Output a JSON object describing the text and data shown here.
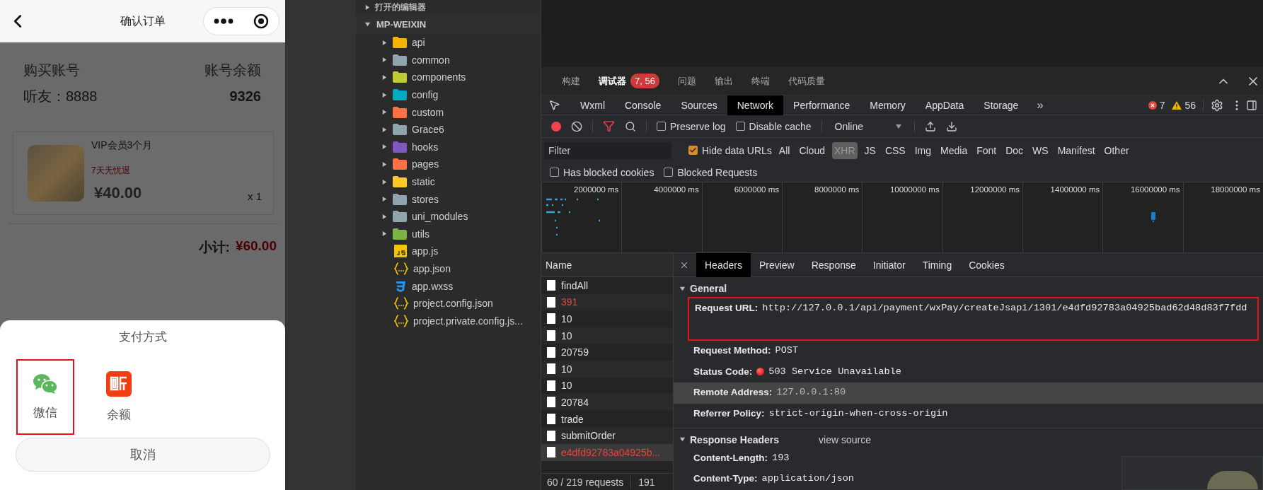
{
  "phone": {
    "nav_title": "确认订单",
    "account": {
      "label": "购买账号",
      "value": "听友：8888"
    },
    "balance": {
      "label": "账号余额",
      "value": "9326"
    },
    "product": {
      "title": "VIP会员3个月",
      "tag": "7天无忧退",
      "price": "¥40.00",
      "quantity": "x 1"
    },
    "subtotal": {
      "label": "小计:",
      "amount": "¥60.00"
    },
    "payment_sheet": {
      "title": "支付方式",
      "methods": [
        {
          "label": "微信",
          "kind": "wechat",
          "highlighted": true
        },
        {
          "label": "余额",
          "kind": "balance",
          "highlighted": false
        }
      ],
      "cancel": "取消"
    }
  },
  "explorer": {
    "open_editors": "打开的编辑器",
    "project": "MP-WEIXIN",
    "items": [
      {
        "name": "api",
        "kind": "folder",
        "color": "#f5b400"
      },
      {
        "name": "common",
        "kind": "folder",
        "color": "#90a4ae"
      },
      {
        "name": "components",
        "kind": "folder",
        "color": "#c0ca33"
      },
      {
        "name": "config",
        "kind": "folder",
        "color": "#00acc1"
      },
      {
        "name": "custom",
        "kind": "folder",
        "color": "#ff7043"
      },
      {
        "name": "Grace6",
        "kind": "folder",
        "color": "#90a4ae"
      },
      {
        "name": "hooks",
        "kind": "folder",
        "color": "#7e57c2"
      },
      {
        "name": "pages",
        "kind": "folder",
        "color": "#ff7043"
      },
      {
        "name": "static",
        "kind": "folder",
        "color": "#ffca28"
      },
      {
        "name": "stores",
        "kind": "folder",
        "color": "#90a4ae"
      },
      {
        "name": "uni_modules",
        "kind": "folder",
        "color": "#90a4ae"
      },
      {
        "name": "utils",
        "kind": "folder",
        "color": "#7cb342"
      },
      {
        "name": "app.js",
        "kind": "js"
      },
      {
        "name": "app.json",
        "kind": "json"
      },
      {
        "name": "app.wxss",
        "kind": "css"
      },
      {
        "name": "project.config.json",
        "kind": "json"
      },
      {
        "name": "project.private.config.js...",
        "kind": "json"
      }
    ]
  },
  "devtools": {
    "top_tabs": [
      {
        "label": "构建",
        "selected": false
      },
      {
        "label": "调试器",
        "selected": true,
        "badge": "7, 56"
      },
      {
        "label": "问题",
        "selected": false
      },
      {
        "label": "输出",
        "selected": false
      },
      {
        "label": "终端",
        "selected": false
      },
      {
        "label": "代码质量",
        "selected": false
      }
    ],
    "panel_tabs": [
      {
        "label": "Wxml",
        "selected": false
      },
      {
        "label": "Console",
        "selected": false
      },
      {
        "label": "Sources",
        "selected": false
      },
      {
        "label": "Network",
        "selected": true
      },
      {
        "label": "Performance",
        "selected": false
      },
      {
        "label": "Memory",
        "selected": false
      },
      {
        "label": "AppData",
        "selected": false
      },
      {
        "label": "Storage",
        "selected": false
      }
    ],
    "more_tabs": "»",
    "error_count": "7",
    "warning_count": "56",
    "toolbar": {
      "recording": true,
      "checkboxes": [
        {
          "label": "Preserve log",
          "checked": false
        },
        {
          "label": "Disable cache",
          "checked": false
        }
      ],
      "throttling": "Online"
    },
    "filter": {
      "placeholder": "Filter",
      "hide_data_urls": {
        "label": "Hide data URLs",
        "checked": true
      },
      "types": [
        {
          "label": "All",
          "selected": false
        },
        {
          "label": "Cloud",
          "selected": false
        },
        {
          "label": "XHR",
          "selected": true
        },
        {
          "label": "JS",
          "selected": false
        },
        {
          "label": "CSS",
          "selected": false
        },
        {
          "label": "Img",
          "selected": false
        },
        {
          "label": "Media",
          "selected": false
        },
        {
          "label": "Font",
          "selected": false
        },
        {
          "label": "Doc",
          "selected": false
        },
        {
          "label": "WS",
          "selected": false
        },
        {
          "label": "Manifest",
          "selected": false
        },
        {
          "label": "Other",
          "selected": false
        }
      ]
    },
    "blocked_filters": [
      {
        "label": "Has blocked cookies",
        "checked": false
      },
      {
        "label": "Blocked Requests",
        "checked": false
      }
    ],
    "timeline_ticks": [
      "2000000 ms",
      "4000000 ms",
      "6000000 ms",
      "8000000 ms",
      "10000000 ms",
      "12000000 ms",
      "14000000 ms",
      "16000000 ms",
      "18000000 ms"
    ],
    "requests": {
      "column": "Name",
      "rows": [
        {
          "name": "findAll",
          "error": false,
          "selected": false
        },
        {
          "name": "391",
          "error": true,
          "selected": false
        },
        {
          "name": "10",
          "error": false,
          "selected": false
        },
        {
          "name": "10",
          "error": false,
          "selected": false
        },
        {
          "name": "20759",
          "error": false,
          "selected": false
        },
        {
          "name": "10",
          "error": false,
          "selected": false
        },
        {
          "name": "10",
          "error": false,
          "selected": false
        },
        {
          "name": "20784",
          "error": false,
          "selected": false
        },
        {
          "name": "trade",
          "error": false,
          "selected": false
        },
        {
          "name": "submitOrder",
          "error": false,
          "selected": false
        },
        {
          "name": "e4dfd92783a04925b...",
          "error": true,
          "selected": true
        }
      ],
      "summary": "60 / 219 requests",
      "transferred": "191"
    },
    "details": {
      "tabs": [
        {
          "label": "Headers",
          "selected": true
        },
        {
          "label": "Preview",
          "selected": false
        },
        {
          "label": "Response",
          "selected": false
        },
        {
          "label": "Initiator",
          "selected": false
        },
        {
          "label": "Timing",
          "selected": false
        },
        {
          "label": "Cookies",
          "selected": false
        }
      ],
      "general": {
        "title": "General",
        "rows": [
          {
            "label": "Request URL:",
            "value": "http://127.0.0.1/api/payment/wxPay/createJsapi/1301/e4dfd92783a04925bad62d48d83f7fdd",
            "kind": "text",
            "highlighted": true,
            "selected": false
          },
          {
            "label": "Request Method:",
            "value": "POST",
            "kind": "text",
            "highlighted": false,
            "selected": false
          },
          {
            "label": "Status Code:",
            "value": "503 Service Unavailable",
            "kind": "status",
            "highlighted": false,
            "selected": false
          },
          {
            "label": "Remote Address:",
            "value": "127.0.0.1:80",
            "kind": "text",
            "highlighted": false,
            "selected": true
          },
          {
            "label": "Referrer Policy:",
            "value": "strict-origin-when-cross-origin",
            "kind": "text",
            "highlighted": false,
            "selected": false
          }
        ]
      },
      "response_headers": {
        "title": "Response Headers",
        "view_source": "view source",
        "rows": [
          {
            "label": "Content-Length:",
            "value": "193"
          },
          {
            "label": "Content-Type:",
            "value": "application/json"
          }
        ]
      }
    }
  }
}
